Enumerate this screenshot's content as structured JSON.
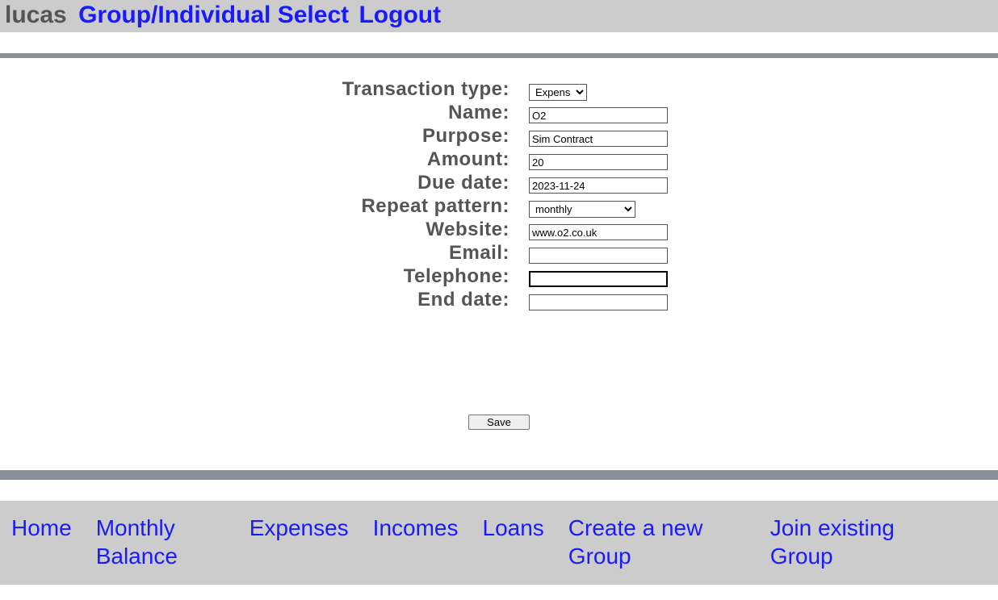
{
  "header": {
    "username": "lucas",
    "links": {
      "group_select": "Group/Individual Select",
      "logout": "Logout"
    }
  },
  "form": {
    "labels": {
      "transaction_type": "Transaction type:",
      "name": "Name:",
      "purpose": "Purpose:",
      "amount": "Amount:",
      "due_date": "Due date:",
      "repeat_pattern": "Repeat pattern:",
      "website": "Website:",
      "email": "Email:",
      "telephone": "Telephone:",
      "end_date": "End date:"
    },
    "values": {
      "transaction_type_selected": "Expense",
      "name": "O2",
      "purpose": "Sim Contract",
      "amount": "20",
      "due_date": "2023-11-24",
      "repeat_pattern_selected": "monthly",
      "website": "www.o2.co.uk",
      "email": "",
      "telephone": "",
      "end_date": ""
    },
    "save_label": "Save"
  },
  "footer": {
    "links": {
      "home": "Home",
      "monthly_balance": "Monthly Balance",
      "expenses": "Expenses",
      "incomes": "Incomes",
      "loans": "Loans",
      "create_group": "Create a new Group",
      "join_group": "Join existing Group"
    }
  }
}
